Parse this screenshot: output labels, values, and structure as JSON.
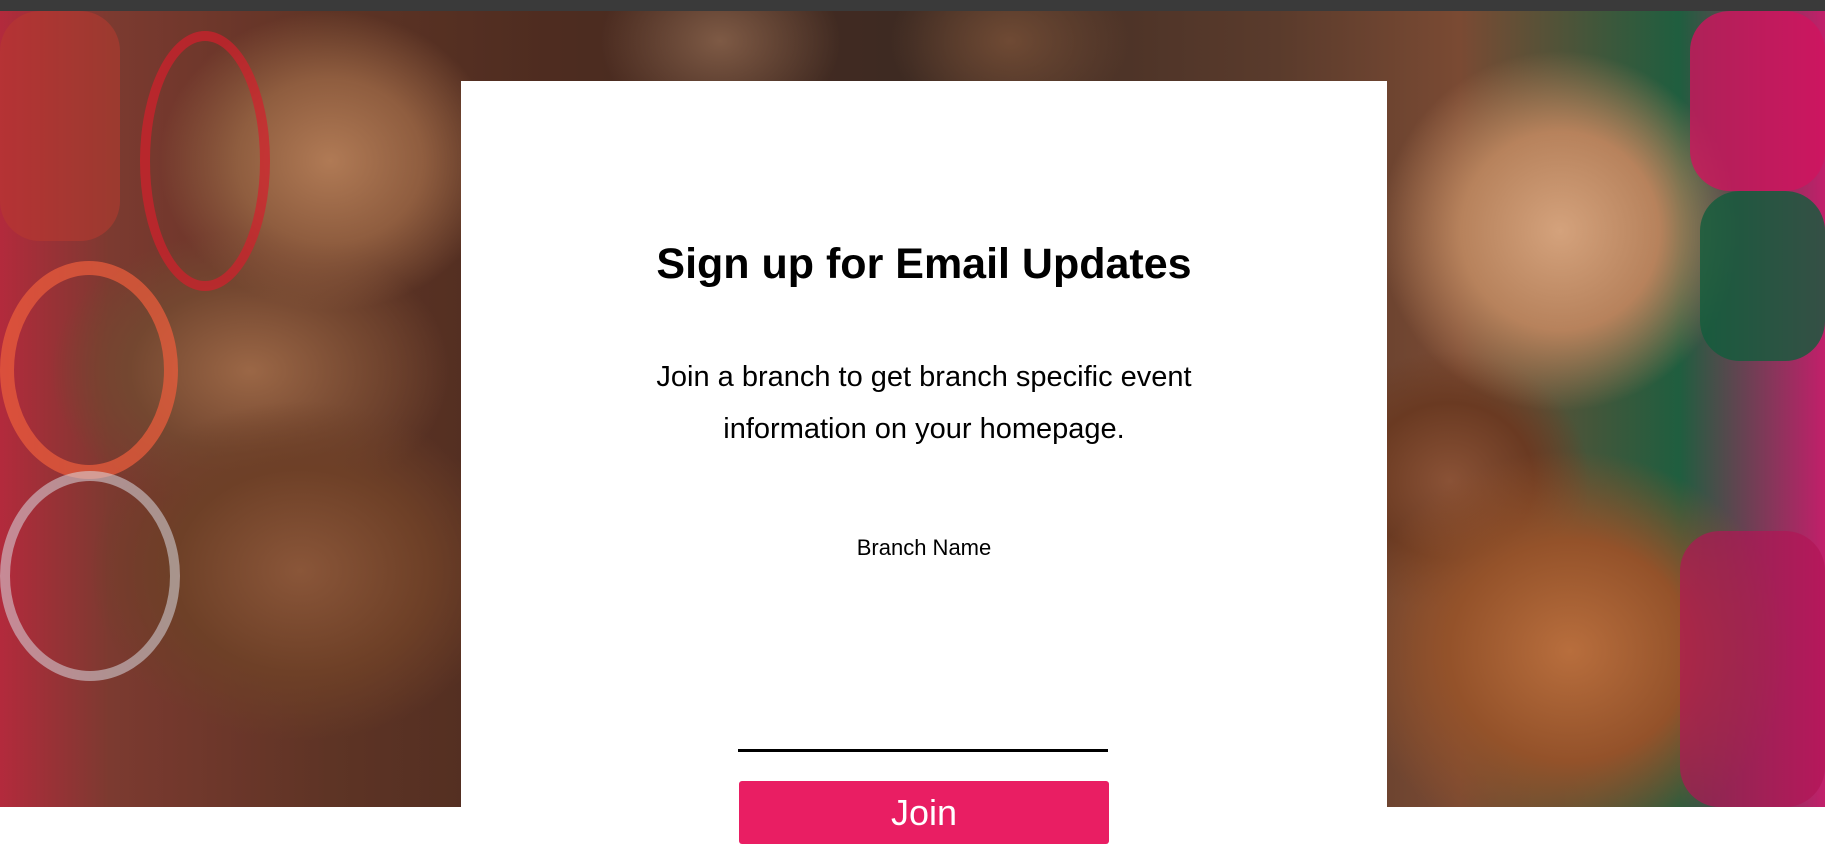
{
  "signup": {
    "title": "Sign up for Email Updates",
    "description": "Join a branch to get branch specific event information on your homepage.",
    "branch_label": "Branch Name",
    "branch_value": "",
    "join_label": "Join"
  },
  "colors": {
    "join_button": "#e91e63",
    "card_background": "#ffffff",
    "top_bar": "#3a3a3a"
  }
}
